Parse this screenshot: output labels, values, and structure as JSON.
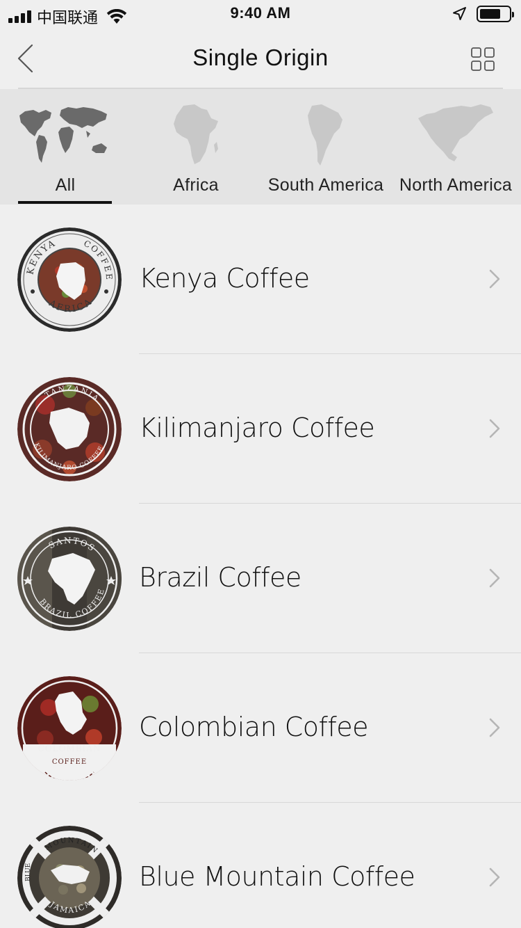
{
  "status_bar": {
    "carrier": "中国联通",
    "time": "9:40 AM"
  },
  "nav": {
    "title": "Single Origin"
  },
  "regions": [
    {
      "label": "All",
      "selected": true
    },
    {
      "label": "Africa",
      "selected": false
    },
    {
      "label": "South America",
      "selected": false
    },
    {
      "label": "North America",
      "selected": false
    }
  ],
  "coffees": [
    {
      "name": "Kenya Coffee",
      "badge_top": "KENYA",
      "badge_top2": "COFFEE",
      "badge_bottom": "AFRICA"
    },
    {
      "name": "Kilimanjaro Coffee",
      "badge_top": "TANZANIA",
      "badge_bottom": "KILIMANJARO COFFEE"
    },
    {
      "name": "Brazil Coffee",
      "badge_top": "SANTOS",
      "badge_bottom": "BRAZIL COFFEE"
    },
    {
      "name": "Colombian Coffee",
      "badge_top": "COLOMBIAN",
      "badge_bottom": "COFFEE"
    },
    {
      "name": "Blue Mountain Coffee",
      "badge_top": "MOUNTAIN",
      "badge_left": "BLUE",
      "badge_bottom": "JAMAICA"
    }
  ],
  "colors": {
    "background": "#efefef",
    "tab_background": "#e4e4e4",
    "map_active": "#6a6a6a",
    "map_inactive": "#c8c8c8",
    "chevron": "#b5b5b5"
  },
  "icons": {
    "back": "chevron-left-icon",
    "grid": "grid-icon",
    "row": "chevron-right-icon"
  }
}
